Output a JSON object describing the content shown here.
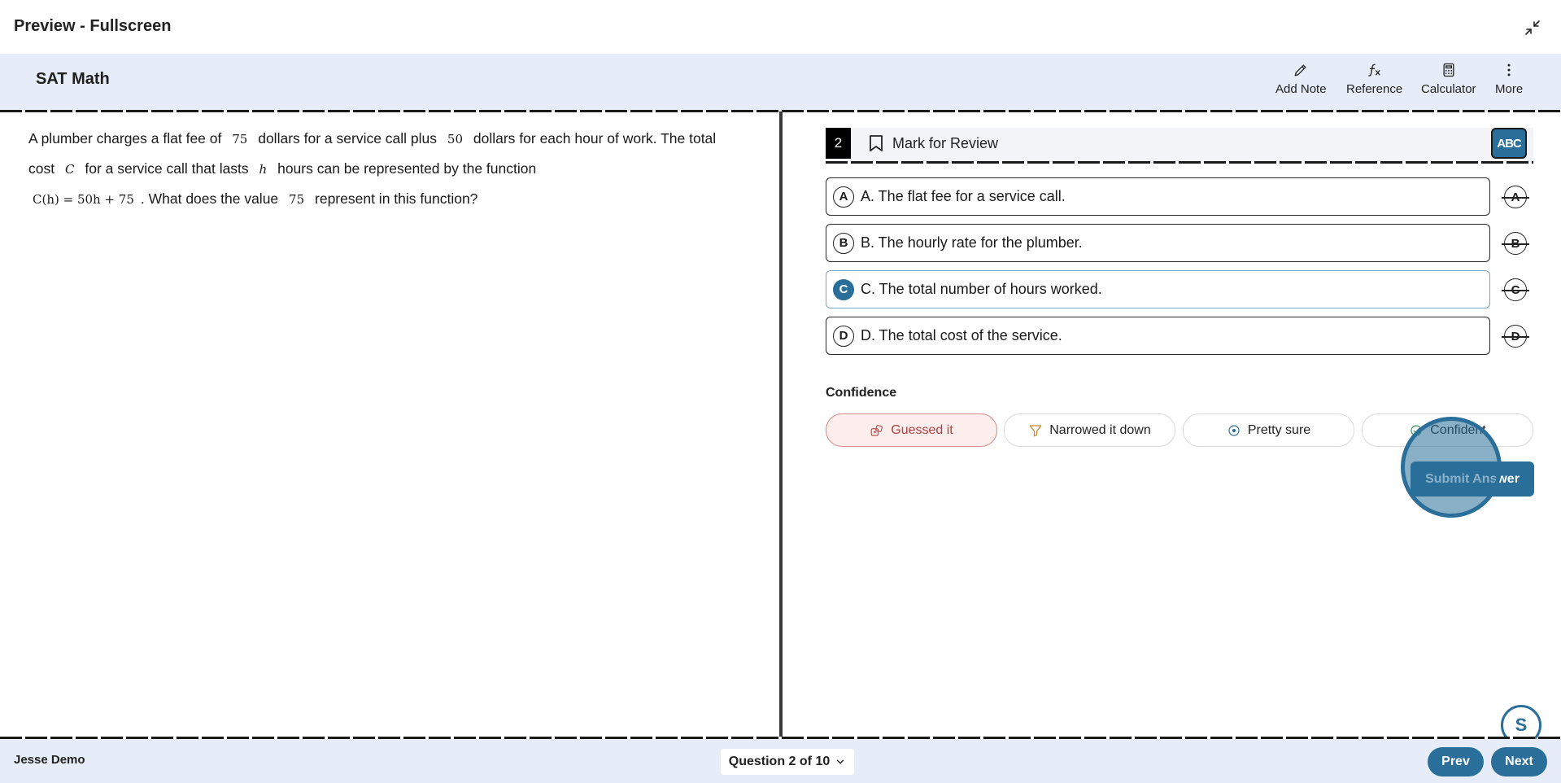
{
  "window": {
    "title": "Preview - Fullscreen",
    "collapse_icon": "collapse-icon"
  },
  "header": {
    "app_title": "SAT Math",
    "tools": [
      {
        "label": "Add Note",
        "icon": "pencil-icon"
      },
      {
        "label": "Reference",
        "icon": "function-icon"
      },
      {
        "label": "Calculator",
        "icon": "calculator-icon"
      },
      {
        "label": "More",
        "icon": "kebab-icon"
      }
    ]
  },
  "question": {
    "text_1": "A plumber charges a flat fee of",
    "m_fee": "75",
    "text_2": "dollars for a service call plus",
    "m_rate": "50",
    "text_3": "dollars for each hour of work. The total cost",
    "m_c": "C",
    "text_4": "for a service call that lasts",
    "m_h": "h",
    "text_5": "hours can be represented by the function",
    "m_fn": "C(h) = 50h + 75",
    "text_6": ". What does the value",
    "m_val": "75",
    "text_7": "represent in this function?"
  },
  "answer_panel": {
    "number": "2",
    "mark_label": "Mark for Review",
    "abc_label": "ABC",
    "selected": "C",
    "choices": [
      {
        "letter": "A",
        "text": "A. The flat fee for a service call."
      },
      {
        "letter": "B",
        "text": "B. The hourly rate for the plumber."
      },
      {
        "letter": "C",
        "text": "C. The total number of hours worked."
      },
      {
        "letter": "D",
        "text": "D. The total cost of the service."
      }
    ],
    "confidence_label": "Confidence",
    "confidence": [
      {
        "label": "Guessed it",
        "icon": "dice-icon"
      },
      {
        "label": "Narrowed it down",
        "icon": "filter-icon"
      },
      {
        "label": "Pretty sure",
        "icon": "target-icon"
      },
      {
        "label": "Confident",
        "icon": "check-circle-icon"
      }
    ],
    "active_confidence": "Guessed it",
    "submit_label": "Submit Answer",
    "fab_label": "S"
  },
  "footer": {
    "user": "Jesse Demo",
    "question_nav": "Question 2 of 10",
    "prev": "Prev",
    "next": "Next"
  },
  "colors": {
    "accent": "#2a6f9a",
    "header_bg": "#e6edf8",
    "guess_bg": "#fdeeee"
  }
}
